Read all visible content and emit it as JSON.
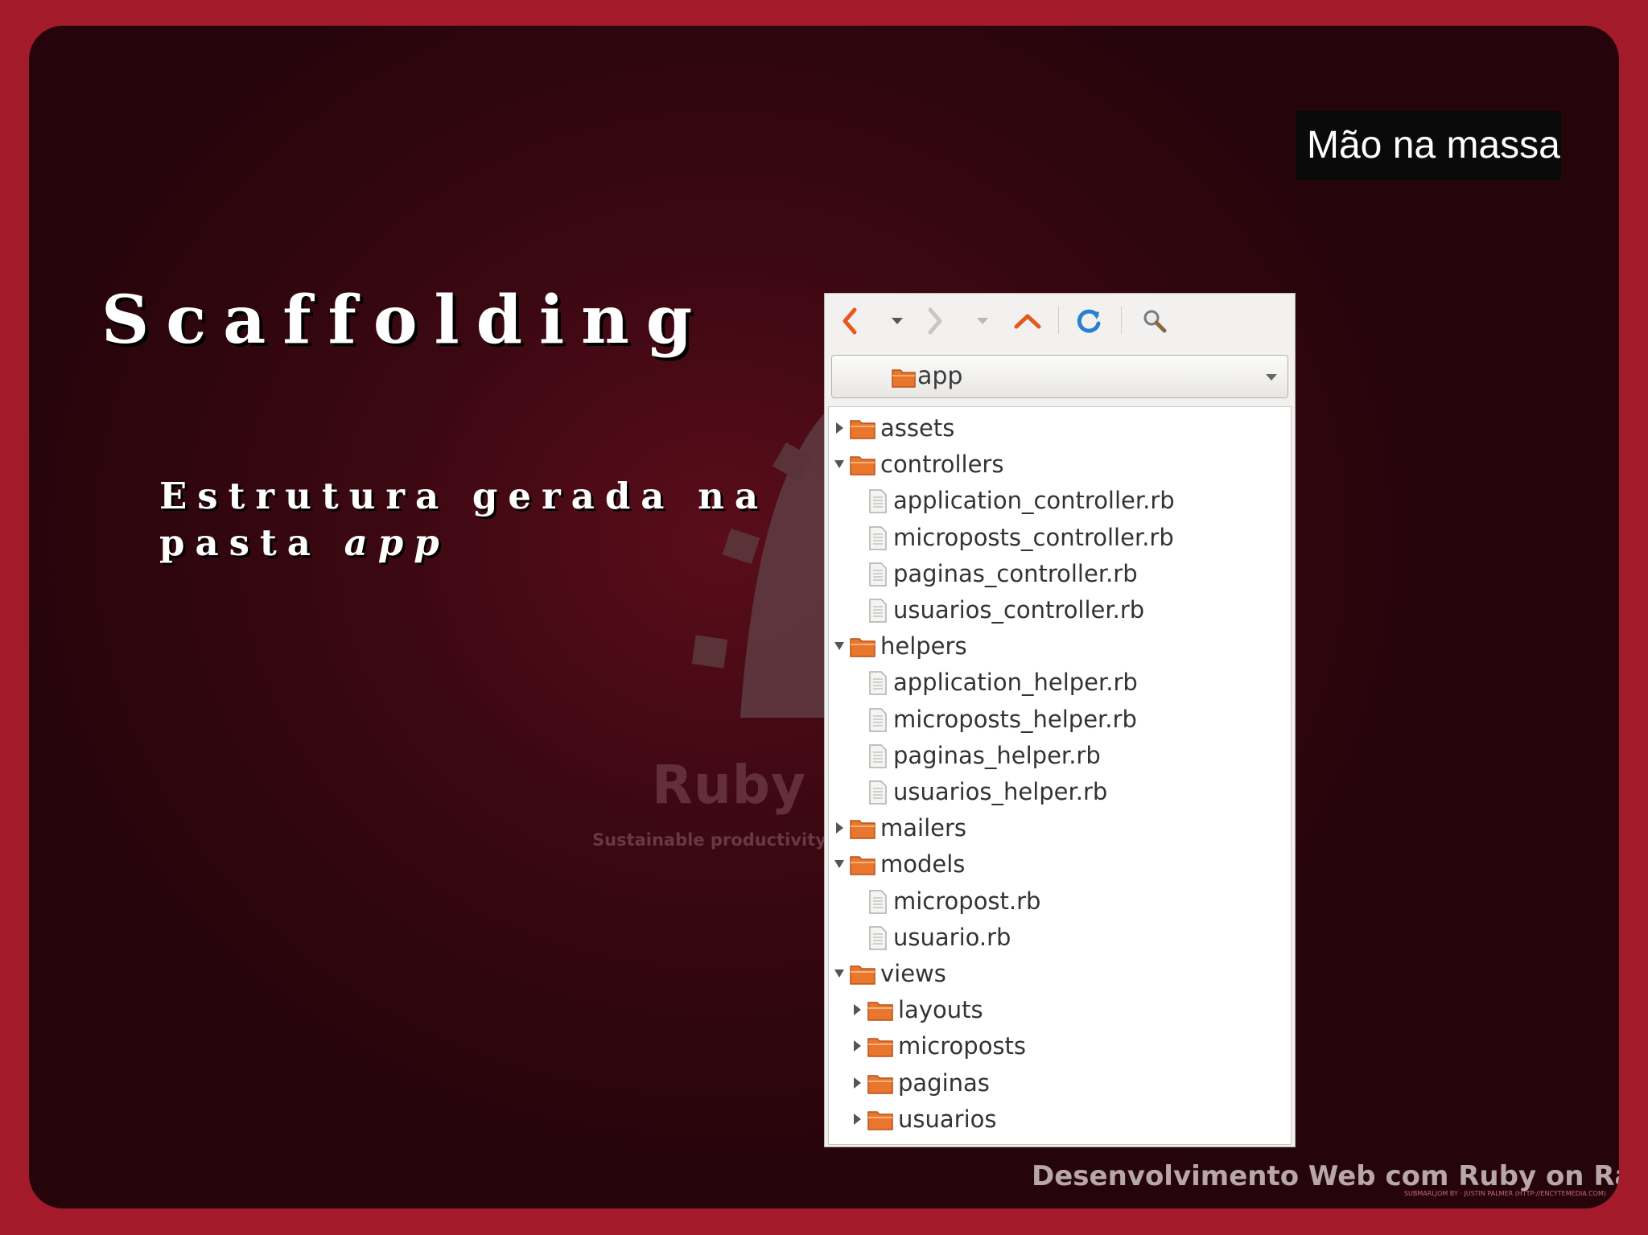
{
  "badge": {
    "text": "Mão na massa"
  },
  "slide": {
    "title": "Scaffolding",
    "subtitle_line1": "Estrutura gerada na",
    "subtitle_line2_prefix": "pasta",
    "subtitle_line2_em": "app",
    "footer": "Desenvolvimento Web com Ruby on Rails",
    "credit": "SUBMARLJOM BY · JUSTIN PALMER (HTTP://ENCYTEMEDIA.COM)"
  },
  "background_logo": {
    "ruby_text": "Ruby o",
    "tagline": "Sustainable productivity for"
  },
  "browser": {
    "toolbar_icons": [
      "back-icon",
      "history-dropdown-icon",
      "forward-icon",
      "forward-history-dropdown-icon",
      "up-icon",
      "reload-icon",
      "search-icon"
    ],
    "location": {
      "value": "app"
    },
    "tree": [
      {
        "label": "assets",
        "type": "folder",
        "depth": 0,
        "expanded": false
      },
      {
        "label": "controllers",
        "type": "folder",
        "depth": 0,
        "expanded": true
      },
      {
        "label": "application_controller.rb",
        "type": "file",
        "depth": 1
      },
      {
        "label": "microposts_controller.rb",
        "type": "file",
        "depth": 1
      },
      {
        "label": "paginas_controller.rb",
        "type": "file",
        "depth": 1
      },
      {
        "label": "usuarios_controller.rb",
        "type": "file",
        "depth": 1
      },
      {
        "label": "helpers",
        "type": "folder",
        "depth": 0,
        "expanded": true
      },
      {
        "label": "application_helper.rb",
        "type": "file",
        "depth": 1
      },
      {
        "label": "microposts_helper.rb",
        "type": "file",
        "depth": 1
      },
      {
        "label": "paginas_helper.rb",
        "type": "file",
        "depth": 1
      },
      {
        "label": "usuarios_helper.rb",
        "type": "file",
        "depth": 1
      },
      {
        "label": "mailers",
        "type": "folder",
        "depth": 0,
        "expanded": false
      },
      {
        "label": "models",
        "type": "folder",
        "depth": 0,
        "expanded": true
      },
      {
        "label": "micropost.rb",
        "type": "file",
        "depth": 1
      },
      {
        "label": "usuario.rb",
        "type": "file",
        "depth": 1
      },
      {
        "label": "views",
        "type": "folder",
        "depth": 0,
        "expanded": true
      },
      {
        "label": "layouts",
        "type": "folder",
        "depth": 1,
        "expanded": false
      },
      {
        "label": "microposts",
        "type": "folder",
        "depth": 1,
        "expanded": false
      },
      {
        "label": "paginas",
        "type": "folder",
        "depth": 1,
        "expanded": false
      },
      {
        "label": "usuarios",
        "type": "folder",
        "depth": 1,
        "expanded": false
      }
    ]
  },
  "colors": {
    "frame": "#a31a2b",
    "slide_dark": "#26040b",
    "folder_orange": "#e8762c",
    "toolbar_arrow": "#e35a1e",
    "reload_blue": "#2a7fd0"
  }
}
